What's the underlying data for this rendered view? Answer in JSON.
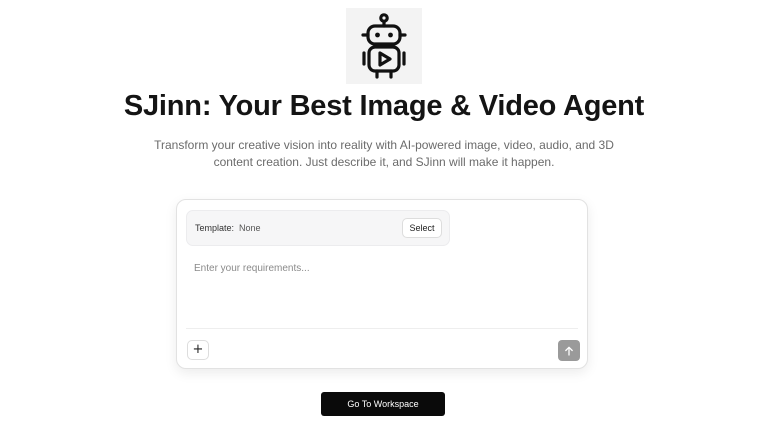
{
  "logo": {
    "icon": "robot-play-icon",
    "background": "#f3f3f3"
  },
  "hero": {
    "title": "SJinn: Your Best Image & Video Agent",
    "subtitle_line1": "Transform your creative vision into reality with AI-powered image, video, audio, and 3D",
    "subtitle_line2": "content creation. Just describe it, and SJinn will make it happen."
  },
  "composer": {
    "template_label": "Template:",
    "template_value": "None",
    "select_label": "Select",
    "input_placeholder": "Enter your requirements...",
    "input_value": "",
    "add_icon": "plus-icon",
    "add_glyph": "+",
    "send_icon": "arrow-up-icon"
  },
  "cta": {
    "workspace_label": "Go To Workspace"
  },
  "colors": {
    "primary_button": "#0a0a0a",
    "send_button_disabled": "#9a9a9a",
    "subtitle_text": "#6b6b6b"
  }
}
